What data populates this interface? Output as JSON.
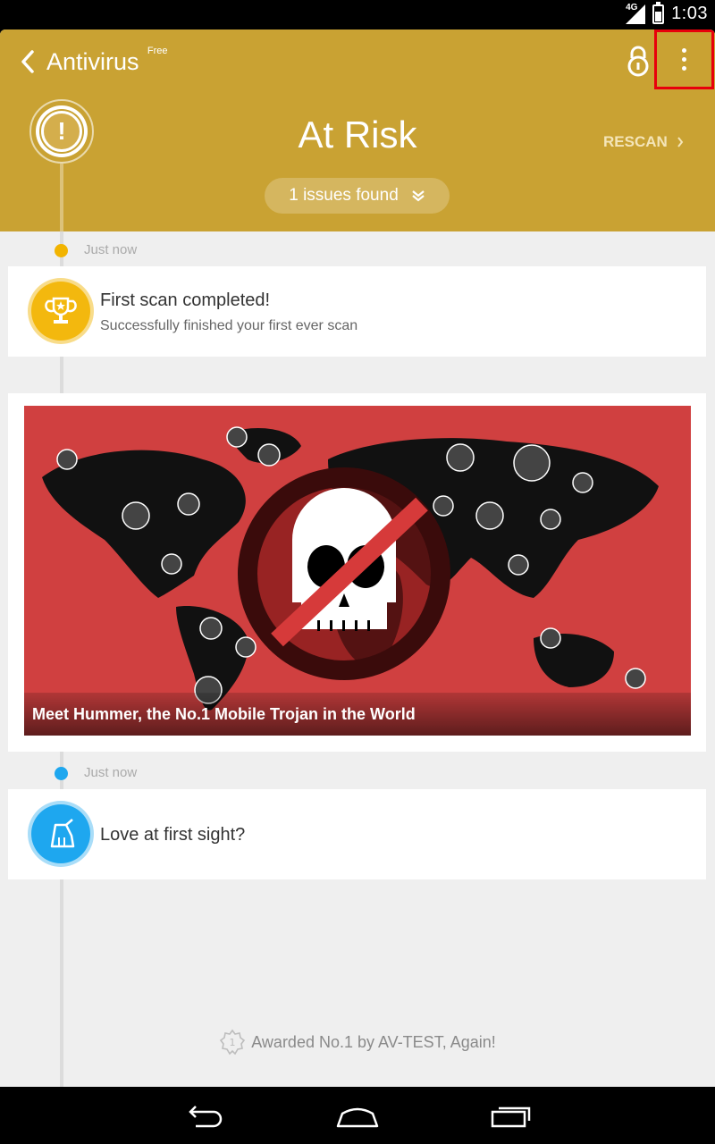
{
  "status_bar": {
    "network": "4G",
    "time": "1:03"
  },
  "header": {
    "back_icon": "chevron-left-icon",
    "app_title": "Antivirus",
    "free_badge": "Free",
    "lock_icon": "lock-icon",
    "menu_icon": "more-vertical-icon",
    "status": "At Risk",
    "rescan_label": "RESCAN",
    "issues_label": "1 issues found",
    "accent_color": "#c9a233"
  },
  "timeline": [
    {
      "time": "Just now",
      "dot_color": "#f2b400",
      "title": "First scan completed!",
      "subtitle": "Successfully finished your first ever scan",
      "icon": "trophy-icon",
      "icon_color": "#f3b80e"
    },
    {
      "banner_caption": "Meet Hummer, the No.1 Mobile Trojan in the World",
      "banner_color": "#d04040"
    },
    {
      "time": "Just now",
      "dot_color": "#1ea7ef",
      "title": "Love at first sight?",
      "icon": "broom-icon",
      "icon_color": "#1ea7ef"
    }
  ],
  "award_text": "Awarded No.1 by AV-TEST, Again!",
  "nav": {
    "back": "back-icon",
    "home": "home-icon",
    "recents": "recents-icon"
  }
}
